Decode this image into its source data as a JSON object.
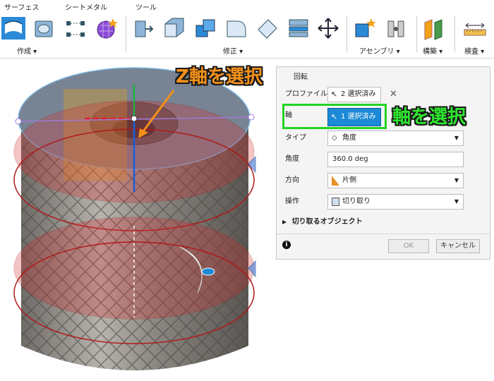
{
  "ribbon": {
    "tabs": [
      "サーフェス",
      "シートメタル",
      "ツール"
    ],
    "groups": {
      "create": "作成 ▾",
      "modify": "修正 ▾",
      "assemble": "アセンブリ ▾",
      "construct": "構築 ▾",
      "inspect": "検査 ▾"
    }
  },
  "annotations": {
    "z_axis": "Z軸を選択",
    "axis": "軸を選択"
  },
  "dialog": {
    "title": "回転",
    "profile_label": "プロファイル",
    "profile_value": "2 選択済み",
    "axis_label": "軸",
    "axis_value": "1 選択済み",
    "type_label": "タイプ",
    "type_value": "角度",
    "angle_label": "角度",
    "angle_value": "360.0 deg",
    "direction_label": "方向",
    "direction_value": "片側",
    "operation_label": "操作",
    "operation_value": "切り取り",
    "objects_label": "切り取るオブジェクト",
    "ok": "OK",
    "cancel": "キャンセル"
  },
  "colors": {
    "accent": "#1c8ad6",
    "highlight": "#22d322",
    "annotation": "#f3901a",
    "selected_body": "#d92a2a"
  }
}
